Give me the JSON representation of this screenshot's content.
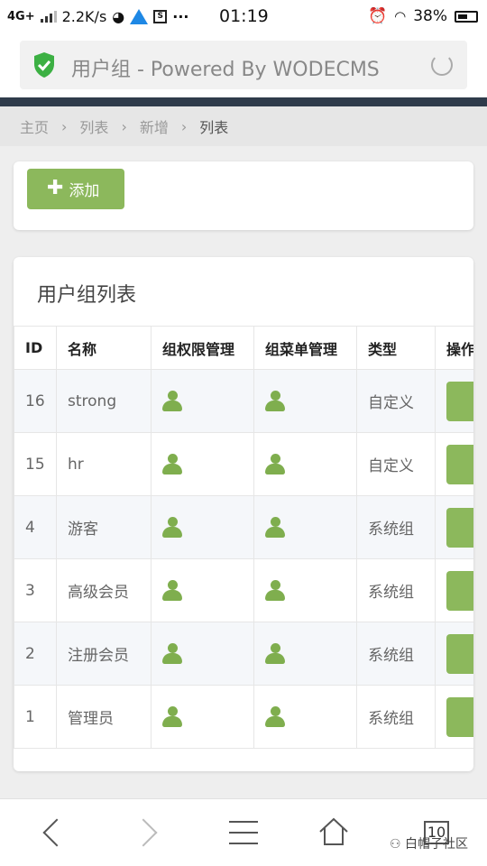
{
  "status_bar": {
    "network": "4G+",
    "speed": "2.2K/s",
    "time": "01:19",
    "battery": "38%"
  },
  "browser": {
    "page_title": "用户组 - Powered By WODECMS",
    "tab_count": "10"
  },
  "breadcrumb": [
    "主页",
    "列表",
    "新增",
    "列表"
  ],
  "toolbar": {
    "add_label": "添加"
  },
  "table": {
    "title": "用户组列表",
    "columns": [
      "ID",
      "名称",
      "组权限管理",
      "组菜单管理",
      "类型",
      "操作"
    ],
    "rows": [
      {
        "id": "16",
        "name": "strong",
        "type": "自定义"
      },
      {
        "id": "15",
        "name": "hr",
        "type": "自定义"
      },
      {
        "id": "4",
        "name": "游客",
        "type": "系统组"
      },
      {
        "id": "3",
        "name": "高级会员",
        "type": "系统组"
      },
      {
        "id": "2",
        "name": "注册会员",
        "type": "系统组"
      },
      {
        "id": "1",
        "name": "管理员",
        "type": "系统组"
      }
    ]
  },
  "watermark": "白帽子社区",
  "colors": {
    "accent": "#8cb85c",
    "header_bar": "#2f3b4b",
    "shield": "#3cb043"
  },
  "icons": [
    "shield-check-icon",
    "reload-icon",
    "user-icon",
    "back-icon",
    "forward-icon",
    "menu-icon",
    "home-icon",
    "tabs-icon"
  ]
}
